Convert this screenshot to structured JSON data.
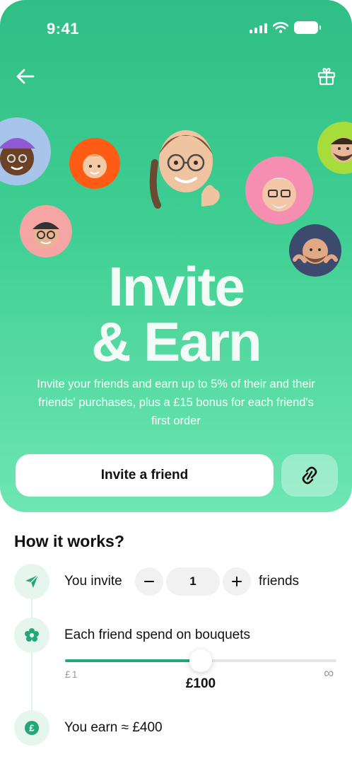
{
  "status_bar": {
    "time": "9:41"
  },
  "hero": {
    "headline_line1": "Invite",
    "headline_line2": "& Earn",
    "subtitle": "Invite your friends and earn up to 5% of their and their friends' purchases, plus a £15 bonus for each friend's first order",
    "invite_button_label": "Invite a friend",
    "icons": {
      "back": "arrow-left-icon",
      "gift": "gift-icon",
      "link": "link-icon"
    }
  },
  "how_it_works": {
    "title": "How it works?",
    "step1": {
      "prefix": "You invite",
      "value": "1",
      "suffix": "friends",
      "icon": "paper-plane-icon"
    },
    "step2": {
      "label": "Each friend spend on bouquets",
      "icon": "flower-icon",
      "slider_min_label": "£1",
      "slider_max_label": "∞",
      "slider_value_label": "£100",
      "slider_level": 0.5
    },
    "step3": {
      "label": "You earn ≈ £400",
      "icon": "pound-coin-icon"
    }
  },
  "colors": {
    "accent": "#23a77a",
    "hero_top": "#2fbf86",
    "hero_bottom": "#6ee6b3"
  }
}
